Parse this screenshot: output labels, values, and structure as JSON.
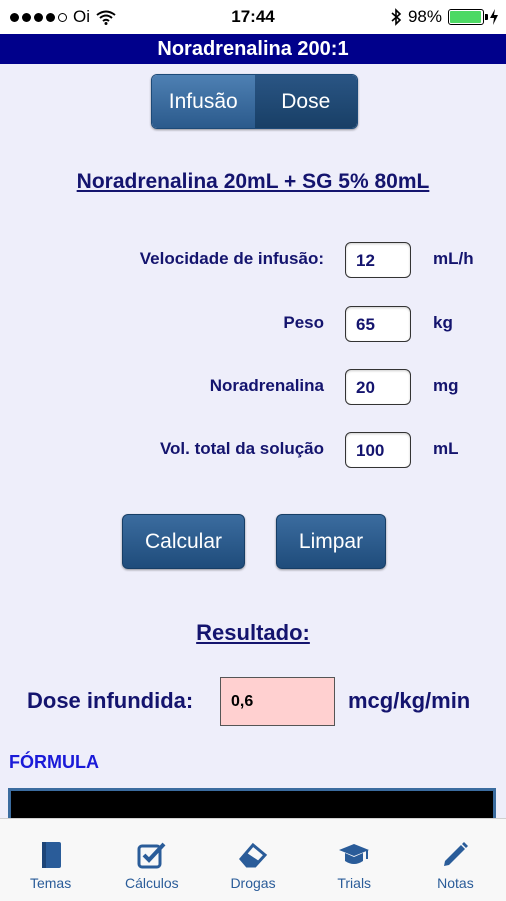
{
  "status_bar": {
    "carrier": "Oi",
    "time": "17:44",
    "battery": "98%",
    "battery_level": 0.98
  },
  "title": "Noradrenalina 200:1",
  "segments": [
    {
      "label": "Infusão",
      "selected": false
    },
    {
      "label": "Dose",
      "selected": true
    }
  ],
  "heading": "Noradrenalina 20mL + SG 5% 80mL",
  "fields": [
    {
      "label": "Velocidade de infusão:",
      "value": "12",
      "unit": "mL/h"
    },
    {
      "label": "Peso",
      "value": "65",
      "unit": "kg"
    },
    {
      "label": "Noradrenalina",
      "value": "20",
      "unit": "mg"
    },
    {
      "label": "Vol. total da solução",
      "value": "100",
      "unit": "mL"
    }
  ],
  "buttons": {
    "calcular": "Calcular",
    "limpar": "Limpar"
  },
  "result": {
    "title": "Resultado:",
    "label": "Dose infundida:",
    "value": "0,6",
    "unit": "mcg/kg/min"
  },
  "formula_label": "FÓRMULA",
  "tabs": [
    {
      "label": "Temas",
      "icon": "book-icon"
    },
    {
      "label": "Cálculos",
      "icon": "checkbox-icon"
    },
    {
      "label": "Drogas",
      "icon": "eraser-icon"
    },
    {
      "label": "Trials",
      "icon": "graduation-cap-icon"
    },
    {
      "label": "Notas",
      "icon": "pencil-icon"
    }
  ],
  "colors": {
    "title_bar": "#00008b",
    "background": "#eeeefa",
    "label_text": "#14146e",
    "button": "#2b5a8c",
    "result_field": "#ffd0d0",
    "formula_label": "#1a1ad8",
    "tab_icon": "#2a5c99"
  }
}
